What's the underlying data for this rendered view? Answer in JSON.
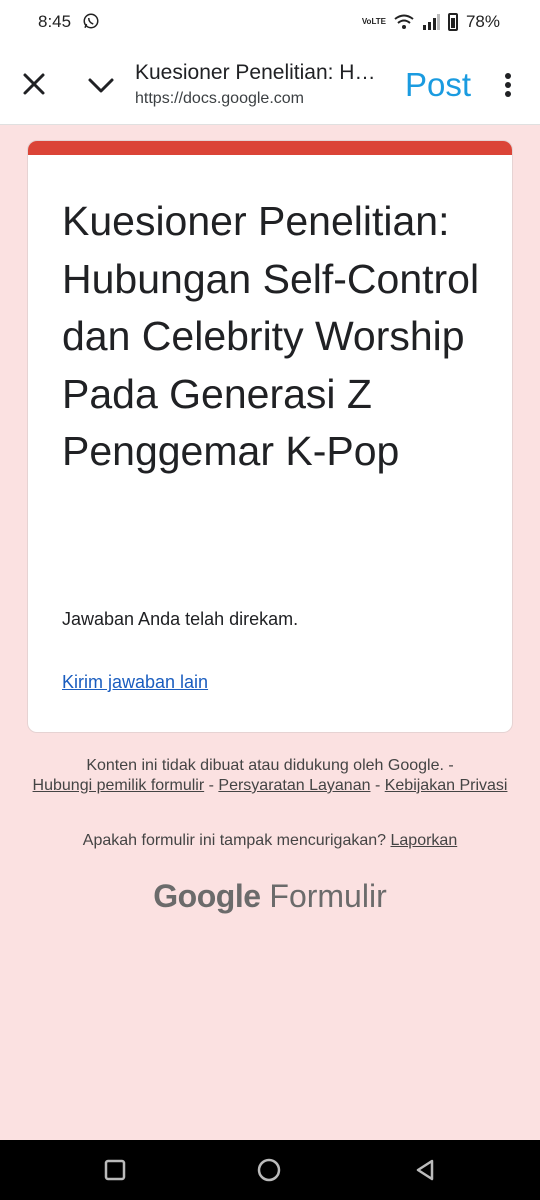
{
  "status_bar": {
    "time": "8:45",
    "network_label": "VoLTE",
    "battery": "78%"
  },
  "toolbar": {
    "title": "Kuesioner Penelitian: Hubungan Self-Control dan Celebrity Worship Pada Generasi Z Penggemar K-Pop",
    "url": "https://docs.google.com",
    "post_label": "Post"
  },
  "form": {
    "accent_color": "#db4437",
    "title": "Kuesioner Penelitian: Hubungan Self-Control dan Celebrity Worship Pada Generasi Z Penggemar K-Pop",
    "confirmation": "Jawaban Anda telah direkam.",
    "submit_another": "Kirim jawaban lain"
  },
  "footer": {
    "disclaimer": "Konten ini tidak dibuat atau didukung oleh Google. -",
    "contact_owner": "Hubungi pemilik formulir",
    "terms": "Persyaratan Layanan",
    "privacy": "Kebijakan Privasi",
    "separator": " - ",
    "suspicious": "Apakah formulir ini tampak mencurigakan?",
    "report": "Laporkan"
  },
  "brand": {
    "google": "Google",
    "product": "Formulir"
  }
}
